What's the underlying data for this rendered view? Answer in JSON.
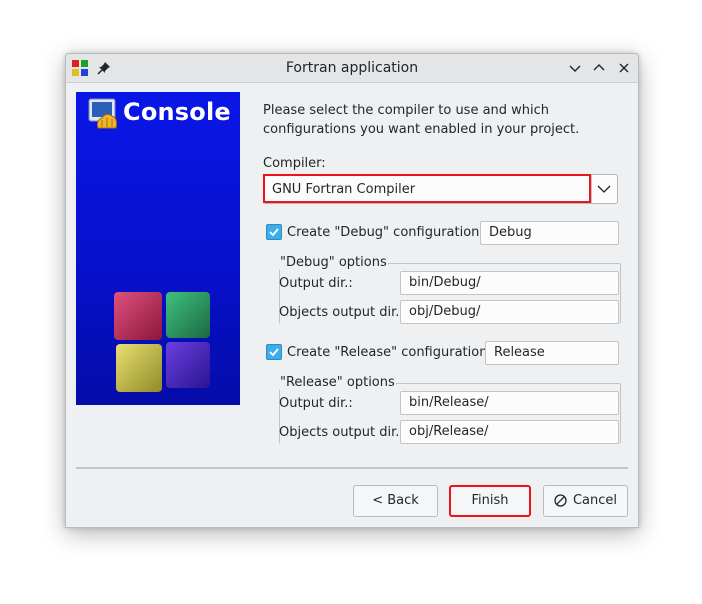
{
  "window": {
    "title": "Fortran application",
    "icons": {
      "app": "codeblocks-app-icon",
      "pin": "pin-icon",
      "minimize": "chevron-down-icon",
      "maximize": "chevron-up-icon",
      "close": "close-icon"
    }
  },
  "banner": {
    "label": "Console",
    "icon": "console-shell-icon",
    "art": "codeblocks-cubes-logo"
  },
  "intro_text": "Please select the compiler to use and which configurations you want enabled in your project.",
  "compiler": {
    "label": "Compiler:",
    "selected": "GNU Fortran Compiler"
  },
  "debug": {
    "checkbox_label": "Create \"Debug\" configuration:",
    "checked": true,
    "name": "Debug",
    "group_title": "\"Debug\" options",
    "output_dir_label": "Output dir.:",
    "output_dir": "bin/Debug/",
    "objects_dir_label": "Objects output dir.:",
    "objects_dir": "obj/Debug/"
  },
  "release": {
    "checkbox_label": "Create \"Release\" configuration:",
    "checked": true,
    "name": "Release",
    "group_title": "\"Release\" options",
    "output_dir_label": "Output dir.:",
    "output_dir": "bin/Release/",
    "objects_dir_label": "Objects output dir.:",
    "objects_dir": "obj/Release/"
  },
  "buttons": {
    "back": "< Back",
    "finish": "Finish",
    "cancel": "Cancel"
  },
  "colors": {
    "accent": "#3daee9",
    "highlight": "#e8151c",
    "banner": "#0a16e8"
  }
}
